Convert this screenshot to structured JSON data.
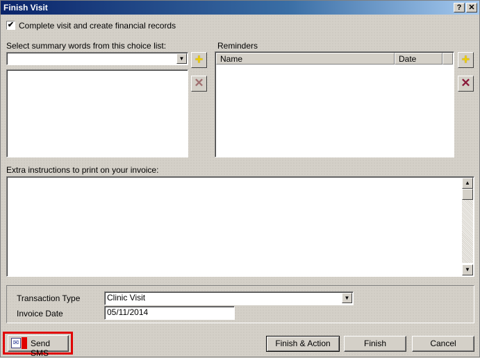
{
  "window": {
    "title": "Finish Visit",
    "help_label": "?",
    "close_label": "✕"
  },
  "complete_visit": {
    "checked": true,
    "check_mark": "✔",
    "label": "Complete visit and create financial records"
  },
  "summary": {
    "label": "Select summary words from this choice list:",
    "selected": ""
  },
  "reminders": {
    "label": "Reminders",
    "columns": [
      "Name",
      "Date"
    ]
  },
  "extra_instructions": {
    "label": "Extra instructions to print on your invoice:",
    "value": ""
  },
  "transaction": {
    "type_label": "Transaction Type",
    "type_value": "Clinic Visit",
    "invoice_label": "Invoice Date",
    "invoice_value": "05/11/2014"
  },
  "buttons": {
    "send_sms": "Send SMS",
    "finish_action": "Finish & Action",
    "finish": "Finish",
    "cancel": "Cancel"
  },
  "icons": {
    "add": "+",
    "delete": "✕",
    "dropdown": "▼",
    "scroll_up": "▲",
    "scroll_down": "▼"
  },
  "highlight_color": "#e00000"
}
